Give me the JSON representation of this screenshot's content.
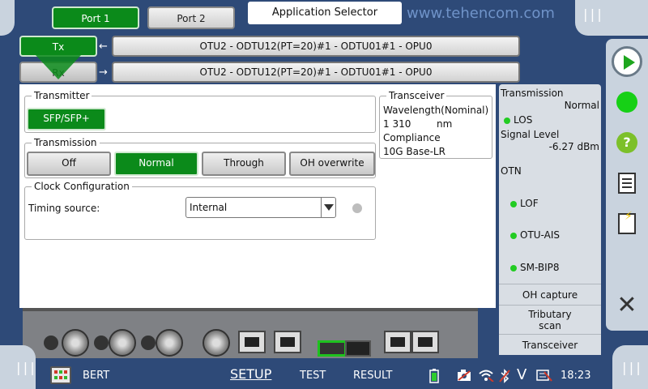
{
  "top": {
    "port1_label": "Port 1",
    "port2_label": "Port 2",
    "app_selector_label": "Application Selector",
    "watermark": "www.tehencom.com"
  },
  "channels": {
    "tx_label": "Tx",
    "rx_label": "Rx",
    "tx_path": "OTU2 - ODTU12(PT=20)#1 - ODTU01#1 - OPU0",
    "rx_path": "OTU2 - ODTU12(PT=20)#1 - ODTU01#1 - OPU0"
  },
  "transmitter": {
    "title": "Transmitter",
    "interface_button": "SFP/SFP+"
  },
  "transceiver": {
    "title": "Transceiver",
    "wavelength_label": "Wavelength(Nominal)",
    "wavelength_value": "1 310",
    "wavelength_unit": "nm",
    "compliance_label": "Compliance",
    "compliance_value": "10G Base-LR"
  },
  "transmission": {
    "title": "Transmission",
    "options": [
      "Off",
      "Normal",
      "Through",
      "OH overwrite"
    ],
    "selected": "Normal"
  },
  "clock": {
    "title": "Clock Configuration",
    "timing_source_label": "Timing source:",
    "timing_source_value": "Internal"
  },
  "status_panel": {
    "transmission_label": "Transmission",
    "transmission_value": "Normal",
    "los_label": "LOS",
    "signal_level_label": "Signal Level",
    "signal_level_value": "-6.27 dBm",
    "otn_label": "OTN",
    "lof_label": "LOF",
    "otu_ais_label": "OTU-AIS",
    "sm_bip8_label": "SM-BIP8",
    "oh_capture_label": "OH capture",
    "tributary_scan_line1": "Tributary",
    "tributary_scan_line2": "scan",
    "transceiver_label": "Transceiver"
  },
  "bottom": {
    "app_name": "BERT",
    "tab_setup": "SETUP",
    "tab_test": "TEST",
    "tab_result": "RESULT",
    "time": "18:23",
    "v_label": "V"
  },
  "colors": {
    "active_green": "#0b8a1a",
    "led_green": "#22cc22",
    "background_blue": "#2e4a78"
  },
  "icons": {
    "play": "play-icon",
    "status": "status-led-icon",
    "help": "help-icon",
    "report": "report-icon",
    "report_bolt": "report-event-icon",
    "exit": "close-icon"
  }
}
